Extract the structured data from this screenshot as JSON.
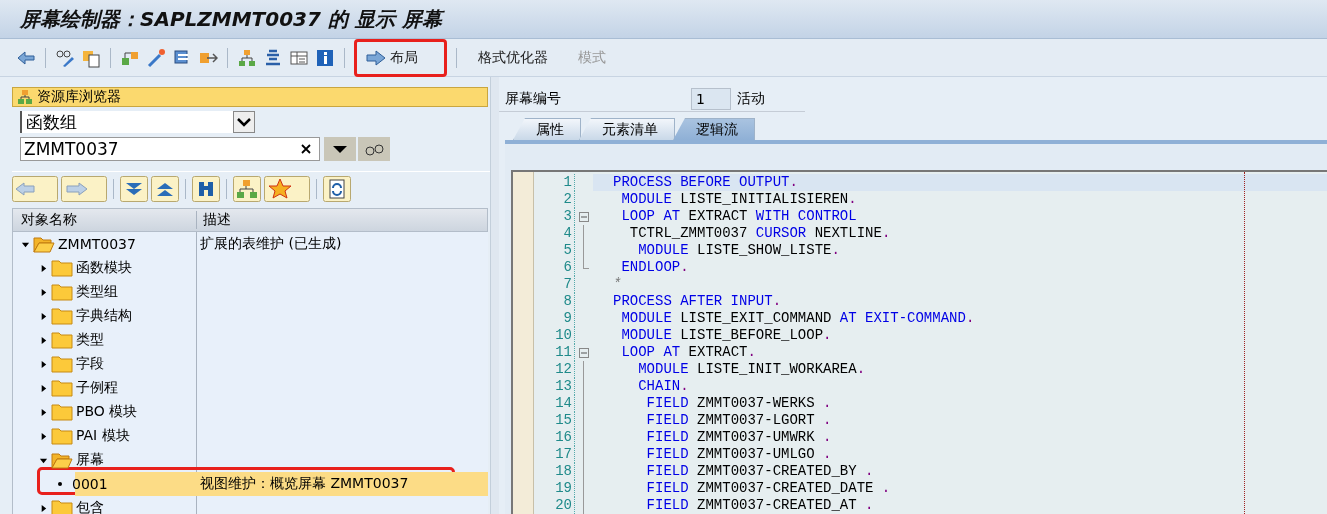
{
  "window": {
    "title": "屏幕绘制器：SAPLZMMT0037 的 显示 屏幕"
  },
  "toolbar": {
    "buttons": [
      {
        "label": "布局",
        "kind": "arrow",
        "disabled": false,
        "highlighted": true
      },
      {
        "label": "格式优化器",
        "kind": "text",
        "disabled": false,
        "highlighted": false
      },
      {
        "label": "模式",
        "kind": "text",
        "disabled": true,
        "highlighted": false
      }
    ]
  },
  "repository_browser": {
    "title": "资源库浏览器",
    "object_type": "函数组",
    "object_name": "ZMMT0037",
    "tree": {
      "columns": [
        "对象名称",
        "描述"
      ],
      "nodes": [
        {
          "name": "ZMMT0037",
          "description": "扩展的表维护 (已生成)",
          "kind": "folder",
          "expanded": true,
          "selected": false,
          "highlighted": false,
          "children": [
            {
              "name": "函数模块",
              "kind": "folder",
              "expanded": false,
              "selected": false,
              "highlighted": false
            },
            {
              "name": "类型组",
              "kind": "folder",
              "expanded": false,
              "selected": false,
              "highlighted": false
            },
            {
              "name": "字典结构",
              "kind": "folder",
              "expanded": false,
              "selected": false,
              "highlighted": false
            },
            {
              "name": "类型",
              "kind": "folder",
              "expanded": false,
              "selected": false,
              "highlighted": false
            },
            {
              "name": "字段",
              "kind": "folder",
              "expanded": false,
              "selected": false,
              "highlighted": false
            },
            {
              "name": "子例程",
              "kind": "folder",
              "expanded": false,
              "selected": false,
              "highlighted": false
            },
            {
              "name": "PBO 模块",
              "kind": "folder",
              "expanded": false,
              "selected": false,
              "highlighted": false
            },
            {
              "name": "PAI 模块",
              "kind": "folder",
              "expanded": false,
              "selected": false,
              "highlighted": false
            },
            {
              "name": "屏幕",
              "kind": "folder",
              "expanded": true,
              "selected": false,
              "highlighted": false,
              "children": [
                {
                  "name": "0001",
                  "description": "视图维护：概览屏幕 ZMMT0037",
                  "kind": "leaf",
                  "selected": true,
                  "highlighted": true
                }
              ]
            },
            {
              "name": "包含",
              "kind": "folder",
              "expanded": false,
              "selected": false,
              "highlighted": false
            }
          ]
        }
      ]
    }
  },
  "screen_header": {
    "label": "屏幕编号",
    "number": "1",
    "status": "活动"
  },
  "tabs": [
    {
      "label": "属性",
      "selected": false
    },
    {
      "label": "元素清单",
      "selected": false
    },
    {
      "label": "逻辑流",
      "selected": true
    }
  ],
  "editor": {
    "lines": [
      {
        "n": "1",
        "current": true,
        "kind": "plain",
        "tokens": [
          {
            "kind": "keyword",
            "text": "PROCESS BEFORE OUTPUT"
          },
          {
            "kind": "punctuation",
            "text": "."
          }
        ]
      },
      {
        "n": "2",
        "current": false,
        "kind": "plain",
        "tokens": [
          {
            "kind": "keyword",
            "text": " MODULE"
          },
          {
            "kind": "identifier",
            "text": " LISTE_INITIALISIEREN"
          },
          {
            "kind": "punctuation",
            "text": "."
          }
        ]
      },
      {
        "n": "3",
        "current": false,
        "kind": "start",
        "tokens": [
          {
            "kind": "keyword",
            "text": " LOOP AT"
          },
          {
            "kind": "identifier",
            "text": " EXTRACT "
          },
          {
            "kind": "keyword",
            "text": "WITH CONTROL"
          }
        ]
      },
      {
        "n": "4",
        "current": false,
        "kind": "inner",
        "tokens": [
          {
            "kind": "identifier",
            "text": "  TCTRL_ZMMT0037 "
          },
          {
            "kind": "keyword",
            "text": "CURSOR"
          },
          {
            "kind": "identifier",
            "text": " NEXTLINE"
          },
          {
            "kind": "punctuation",
            "text": "."
          }
        ]
      },
      {
        "n": "5",
        "current": false,
        "kind": "inner",
        "tokens": [
          {
            "kind": "keyword",
            "text": "   MODULE"
          },
          {
            "kind": "identifier",
            "text": " LISTE_SHOW_LISTE"
          },
          {
            "kind": "punctuation",
            "text": "."
          }
        ]
      },
      {
        "n": "6",
        "current": false,
        "kind": "end",
        "tokens": [
          {
            "kind": "keyword",
            "text": " ENDLOOP"
          },
          {
            "kind": "punctuation",
            "text": "."
          }
        ]
      },
      {
        "n": "7",
        "current": false,
        "kind": "plain",
        "tokens": [
          {
            "kind": "comment",
            "text": "*"
          }
        ]
      },
      {
        "n": "8",
        "current": false,
        "kind": "plain",
        "tokens": [
          {
            "kind": "keyword",
            "text": "PROCESS AFTER INPUT"
          },
          {
            "kind": "punctuation",
            "text": "."
          }
        ]
      },
      {
        "n": "9",
        "current": false,
        "kind": "plain",
        "tokens": [
          {
            "kind": "keyword",
            "text": " MODULE"
          },
          {
            "kind": "identifier",
            "text": " LISTE_EXIT_COMMAND "
          },
          {
            "kind": "keyword",
            "text": "AT EXIT-COMMAND"
          },
          {
            "kind": "punctuation",
            "text": "."
          }
        ]
      },
      {
        "n": "10",
        "current": false,
        "kind": "plain",
        "tokens": [
          {
            "kind": "keyword",
            "text": " MODULE"
          },
          {
            "kind": "identifier",
            "text": " LISTE_BEFORE_LOOP"
          },
          {
            "kind": "punctuation",
            "text": "."
          }
        ]
      },
      {
        "n": "11",
        "current": false,
        "kind": "start",
        "tokens": [
          {
            "kind": "keyword",
            "text": " LOOP AT"
          },
          {
            "kind": "identifier",
            "text": " EXTRACT"
          },
          {
            "kind": "punctuation",
            "text": "."
          }
        ]
      },
      {
        "n": "12",
        "current": false,
        "kind": "inner",
        "tokens": [
          {
            "kind": "keyword",
            "text": "   MODULE"
          },
          {
            "kind": "identifier",
            "text": " LISTE_INIT_WORKAREA"
          },
          {
            "kind": "punctuation",
            "text": "."
          }
        ]
      },
      {
        "n": "13",
        "current": false,
        "kind": "inner",
        "tokens": [
          {
            "kind": "keyword",
            "text": "   CHAIN"
          },
          {
            "kind": "punctuation",
            "text": "."
          }
        ]
      },
      {
        "n": "14",
        "current": false,
        "kind": "inner",
        "tokens": [
          {
            "kind": "keyword",
            "text": "    FIELD"
          },
          {
            "kind": "identifier",
            "text": " ZMMT0037-WERKS "
          },
          {
            "kind": "punctuation",
            "text": "."
          }
        ]
      },
      {
        "n": "15",
        "current": false,
        "kind": "inner",
        "tokens": [
          {
            "kind": "keyword",
            "text": "    FIELD"
          },
          {
            "kind": "identifier",
            "text": " ZMMT0037-LGORT "
          },
          {
            "kind": "punctuation",
            "text": "."
          }
        ]
      },
      {
        "n": "16",
        "current": false,
        "kind": "inner",
        "tokens": [
          {
            "kind": "keyword",
            "text": "    FIELD"
          },
          {
            "kind": "identifier",
            "text": " ZMMT0037-UMWRK "
          },
          {
            "kind": "punctuation",
            "text": "."
          }
        ]
      },
      {
        "n": "17",
        "current": false,
        "kind": "inner",
        "tokens": [
          {
            "kind": "keyword",
            "text": "    FIELD"
          },
          {
            "kind": "identifier",
            "text": " ZMMT0037-UMLGO "
          },
          {
            "kind": "punctuation",
            "text": "."
          }
        ]
      },
      {
        "n": "18",
        "current": false,
        "kind": "inner",
        "tokens": [
          {
            "kind": "keyword",
            "text": "    FIELD"
          },
          {
            "kind": "identifier",
            "text": " ZMMT0037-CREATED_BY "
          },
          {
            "kind": "punctuation",
            "text": "."
          }
        ]
      },
      {
        "n": "19",
        "current": false,
        "kind": "inner",
        "tokens": [
          {
            "kind": "keyword",
            "text": "    FIELD"
          },
          {
            "kind": "identifier",
            "text": " ZMMT0037-CREATED_DATE "
          },
          {
            "kind": "punctuation",
            "text": "."
          }
        ]
      },
      {
        "n": "20",
        "current": false,
        "kind": "inner",
        "tokens": [
          {
            "kind": "keyword",
            "text": "    FIELD"
          },
          {
            "kind": "identifier",
            "text": " ZMMT0037-CREATED_AT "
          },
          {
            "kind": "punctuation",
            "text": "."
          }
        ]
      }
    ]
  }
}
